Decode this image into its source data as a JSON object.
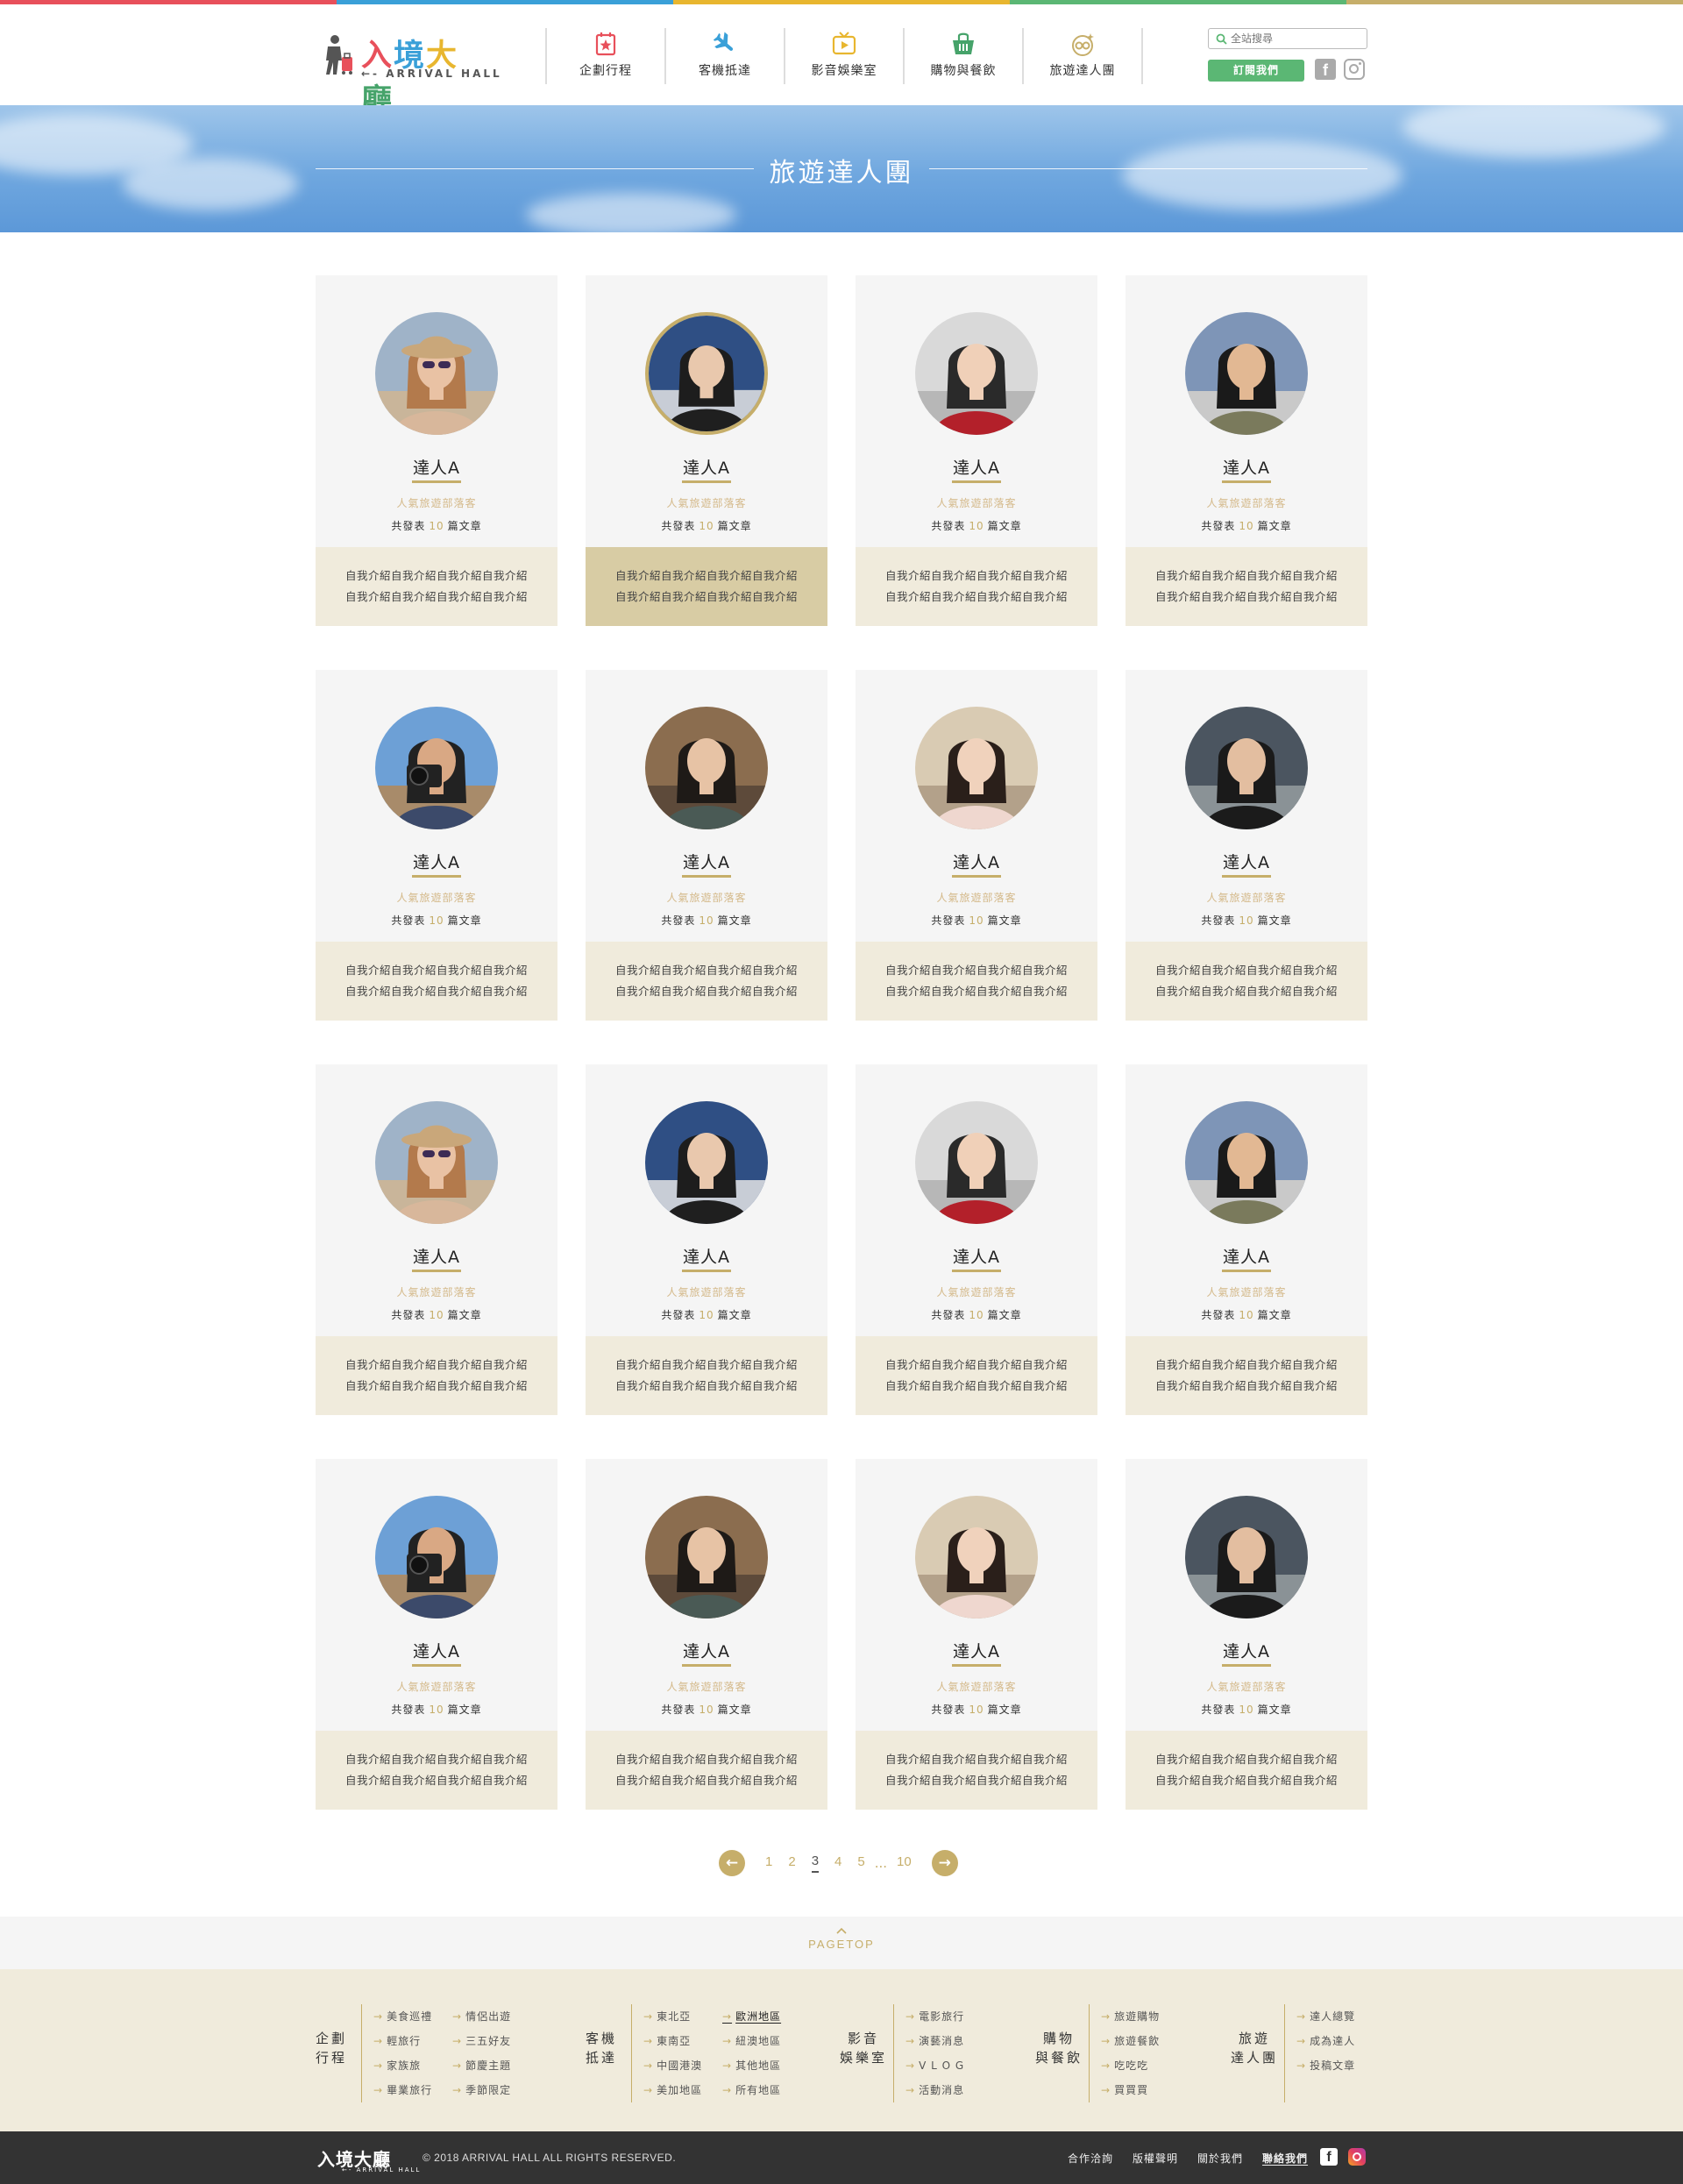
{
  "brand": {
    "logo_cn": [
      "入",
      "境",
      "大",
      "廳"
    ],
    "logo_en": "←- ARRIVAL HALL",
    "stripe_colors": [
      "#e8505b",
      "#3aa0d8",
      "#e8b62f",
      "#5bb774",
      "#c6ae6a"
    ],
    "accent": "#c6ae6a",
    "green": "#5bb774"
  },
  "nav": [
    {
      "label": "企劃行程",
      "icon": "calendar-star-icon",
      "color": "#e8505b"
    },
    {
      "label": "客機抵達",
      "icon": "airplane-icon",
      "color": "#3aa0d8"
    },
    {
      "label": "影音娛樂室",
      "icon": "tv-play-icon",
      "color": "#e8b62f"
    },
    {
      "label": "購物與餐飲",
      "icon": "shopping-basket-icon",
      "color": "#46a36a"
    },
    {
      "label": "旅遊達人團",
      "icon": "sunglasses-icon",
      "color": "#c6ae6a"
    }
  ],
  "search": {
    "placeholder": "全站搜尋"
  },
  "subscribe": {
    "label": "訂閱我們"
  },
  "hero": {
    "title": "旅遊達人團"
  },
  "experts": [
    {
      "name": "達人A",
      "role": "人氣旅遊部落客",
      "count_prefix": "共發表",
      "count": "10",
      "count_suffix": "篇文章",
      "intro": [
        "自我介紹自我介紹自我介紹自我介紹",
        "自我介紹自我介紹自我介紹自我介紹"
      ],
      "photo": "woman-hat-sunglasses",
      "active": false
    },
    {
      "name": "達人A",
      "role": "人氣旅遊部落客",
      "count_prefix": "共發表",
      "count": "10",
      "count_suffix": "篇文章",
      "intro": [
        "自我介紹自我介紹自我介紹自我介紹",
        "自我介紹自我介紹自我介紹自我介紹"
      ],
      "photo": "woman-black-sweater",
      "active": true
    },
    {
      "name": "達人A",
      "role": "人氣旅遊部落客",
      "count_prefix": "共發表",
      "count": "10",
      "count_suffix": "篇文章",
      "intro": [
        "自我介紹自我介紹自我介紹自我介紹",
        "自我介紹自我介紹自我介紹自我介紹"
      ],
      "photo": "flight-attendant",
      "active": false
    },
    {
      "name": "達人A",
      "role": "人氣旅遊部落客",
      "count_prefix": "共發表",
      "count": "10",
      "count_suffix": "篇文章",
      "intro": [
        "自我介紹自我介紹自我介紹自我介紹",
        "自我介紹自我介紹自我介紹自我介紹"
      ],
      "photo": "man-olive-jacket",
      "active": false
    },
    {
      "name": "達人A",
      "role": "人氣旅遊部落客",
      "count_prefix": "共發表",
      "count": "10",
      "count_suffix": "篇文章",
      "intro": [
        "自我介紹自我介紹自我介紹自我介紹",
        "自我介紹自我介紹自我介紹自我介紹"
      ],
      "photo": "photographer-camera",
      "active": false
    },
    {
      "name": "達人A",
      "role": "人氣旅遊部落客",
      "count_prefix": "共發表",
      "count": "10",
      "count_suffix": "篇文章",
      "intro": [
        "自我介紹自我介紹自我介紹自我介紹",
        "自我介紹自我介紹自我介紹自我介紹"
      ],
      "photo": "woman-thinking",
      "active": false
    },
    {
      "name": "達人A",
      "role": "人氣旅遊部落客",
      "count_prefix": "共發表",
      "count": "10",
      "count_suffix": "篇文章",
      "intro": [
        "自我介紹自我介紹自我介紹自我介紹",
        "自我介紹自我介紹自我介紹自我介紹"
      ],
      "photo": "woman-long-hair",
      "active": false
    },
    {
      "name": "達人A",
      "role": "人氣旅遊部落客",
      "count_prefix": "共發表",
      "count": "10",
      "count_suffix": "篇文章",
      "intro": [
        "自我介紹自我介紹自我介紹自我介紹",
        "自我介紹自我介紹自我介紹自我介紹"
      ],
      "photo": "man-smiling-street",
      "active": false
    },
    {
      "name": "達人A",
      "role": "人氣旅遊部落客",
      "count_prefix": "共發表",
      "count": "10",
      "count_suffix": "篇文章",
      "intro": [
        "自我介紹自我介紹自我介紹自我介紹",
        "自我介紹自我介紹自我介紹自我介紹"
      ],
      "photo": "woman-hat-sunglasses",
      "active": false
    },
    {
      "name": "達人A",
      "role": "人氣旅遊部落客",
      "count_prefix": "共發表",
      "count": "10",
      "count_suffix": "篇文章",
      "intro": [
        "自我介紹自我介紹自我介紹自我介紹",
        "自我介紹自我介紹自我介紹自我介紹"
      ],
      "photo": "woman-black-sweater",
      "active": false
    },
    {
      "name": "達人A",
      "role": "人氣旅遊部落客",
      "count_prefix": "共發表",
      "count": "10",
      "count_suffix": "篇文章",
      "intro": [
        "自我介紹自我介紹自我介紹自我介紹",
        "自我介紹自我介紹自我介紹自我介紹"
      ],
      "photo": "flight-attendant",
      "active": false
    },
    {
      "name": "達人A",
      "role": "人氣旅遊部落客",
      "count_prefix": "共發表",
      "count": "10",
      "count_suffix": "篇文章",
      "intro": [
        "自我介紹自我介紹自我介紹自我介紹",
        "自我介紹自我介紹自我介紹自我介紹"
      ],
      "photo": "man-olive-jacket",
      "active": false
    },
    {
      "name": "達人A",
      "role": "人氣旅遊部落客",
      "count_prefix": "共發表",
      "count": "10",
      "count_suffix": "篇文章",
      "intro": [
        "自我介紹自我介紹自我介紹自我介紹",
        "自我介紹自我介紹自我介紹自我介紹"
      ],
      "photo": "photographer-camera",
      "active": false
    },
    {
      "name": "達人A",
      "role": "人氣旅遊部落客",
      "count_prefix": "共發表",
      "count": "10",
      "count_suffix": "篇文章",
      "intro": [
        "自我介紹自我介紹自我介紹自我介紹",
        "自我介紹自我介紹自我介紹自我介紹"
      ],
      "photo": "woman-thinking",
      "active": false
    },
    {
      "name": "達人A",
      "role": "人氣旅遊部落客",
      "count_prefix": "共發表",
      "count": "10",
      "count_suffix": "篇文章",
      "intro": [
        "自我介紹自我介紹自我介紹自我介紹",
        "自我介紹自我介紹自我介紹自我介紹"
      ],
      "photo": "woman-long-hair",
      "active": false
    },
    {
      "name": "達人A",
      "role": "人氣旅遊部落客",
      "count_prefix": "共發表",
      "count": "10",
      "count_suffix": "篇文章",
      "intro": [
        "自我介紹自我介紹自我介紹自我介紹",
        "自我介紹自我介紹自我介紹自我介紹"
      ],
      "photo": "man-smiling-street",
      "active": false
    }
  ],
  "pagination": {
    "prev_icon": "arrow-left-icon",
    "next_icon": "arrow-right-icon",
    "pages": [
      "1",
      "2",
      "3",
      "4",
      "5"
    ],
    "current": "3",
    "ellipsis": "...",
    "last": "10"
  },
  "pagetop": {
    "label": "PAGETOP"
  },
  "footer": {
    "columns": [
      {
        "head": [
          "企劃",
          "行程"
        ],
        "lists": [
          [
            "美食巡禮",
            "輕旅行",
            "家族旅",
            "畢業旅行"
          ],
          [
            "情侶出遊",
            "三五好友",
            "節慶主題",
            "季節限定"
          ]
        ]
      },
      {
        "head": [
          "客機",
          "抵達"
        ],
        "lists": [
          [
            "東北亞",
            "東南亞",
            "中國港澳",
            "美加地區"
          ],
          [
            "歐洲地區",
            "紐澳地區",
            "其他地區",
            "所有地區"
          ]
        ],
        "highlight": "歐洲地區"
      },
      {
        "head": [
          "影音",
          "娛樂室"
        ],
        "lists": [
          [
            "電影旅行",
            "演藝消息",
            "V L O G",
            "活動消息"
          ]
        ]
      },
      {
        "head": [
          "購物",
          "與餐飲"
        ],
        "lists": [
          [
            "旅遊購物",
            "旅遊餐飲",
            "吃吃吃",
            "買買買"
          ]
        ]
      },
      {
        "head": [
          "旅遊",
          "達人團"
        ],
        "lists": [
          [
            "達人總覽",
            "成為達人",
            "投稿文章"
          ]
        ]
      }
    ],
    "logo": "入境大廳",
    "logo_en": "←- ARRIVAL HALL",
    "copyright": "© 2018 ARRIVAL HALL ALL RIGHTS RESERVED.",
    "links": [
      "合作洽詢",
      "版權聲明",
      "關於我們",
      "聯絡我們"
    ],
    "links_highlight": "聯絡我們"
  }
}
